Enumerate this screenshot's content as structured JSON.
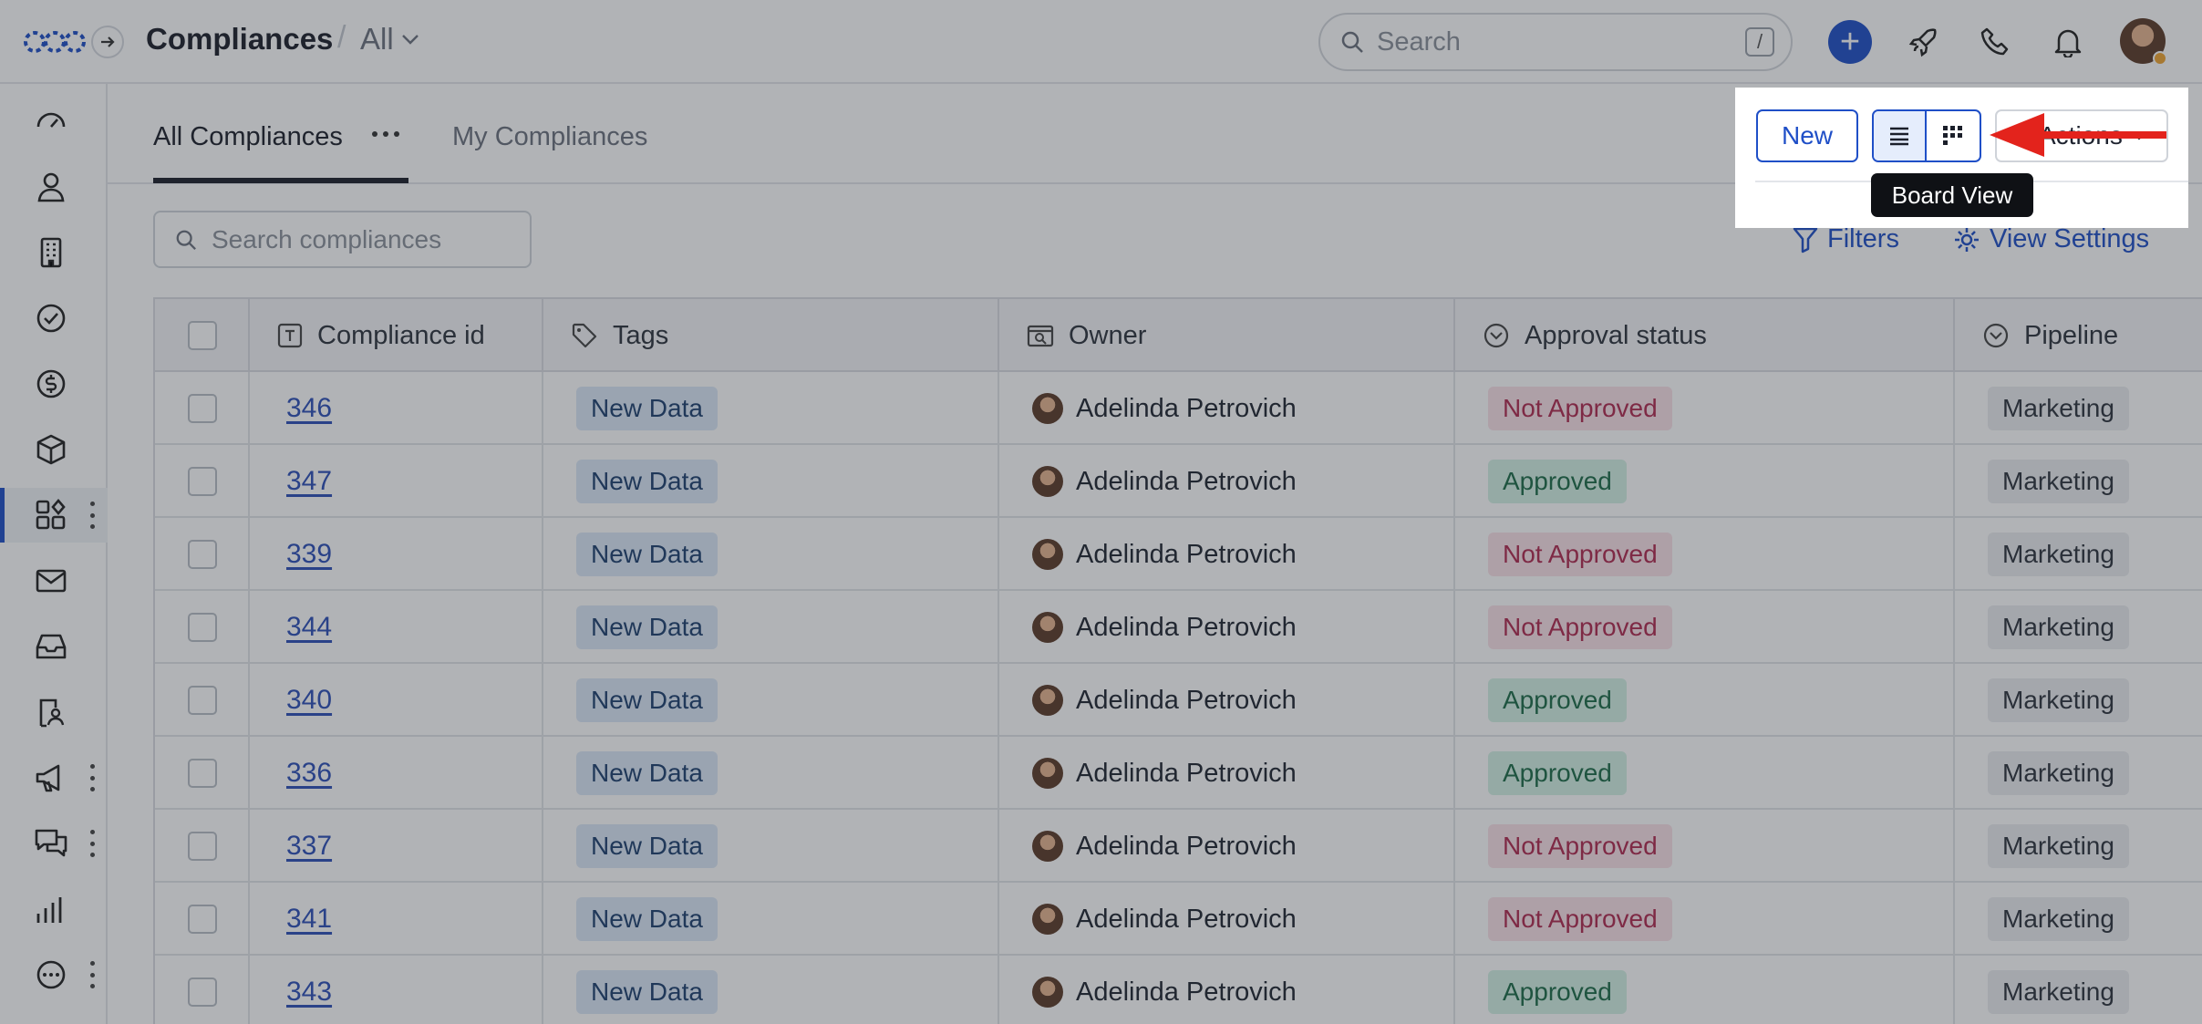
{
  "header": {
    "title": "Compliances",
    "separator": "/",
    "view_selector": "All",
    "search_placeholder": "Search",
    "search_shortcut": "/",
    "add_symbol": "+"
  },
  "sidebar": {
    "items": [
      {
        "icon": "gauge-icon"
      },
      {
        "icon": "person-icon"
      },
      {
        "icon": "building-icon"
      },
      {
        "icon": "check-circle-icon"
      },
      {
        "icon": "dollar-icon"
      },
      {
        "icon": "box-icon"
      },
      {
        "icon": "apps-icon",
        "active": true
      },
      {
        "icon": "mail-icon"
      },
      {
        "icon": "inbox-icon"
      },
      {
        "icon": "contact-card-icon"
      },
      {
        "icon": "megaphone-icon"
      },
      {
        "icon": "chat-icon"
      },
      {
        "icon": "bar-chart-icon"
      },
      {
        "icon": "more-circle-icon"
      }
    ]
  },
  "tabs": {
    "all": "All Compliances",
    "mine": "My Compliances"
  },
  "toolbar": {
    "new_label": "New",
    "actions_label": "Actions",
    "tooltip": "Board View",
    "search_placeholder": "Search compliances",
    "filters_label": "Filters",
    "view_settings_label": "View Settings"
  },
  "table": {
    "columns": {
      "id": "Compliance id",
      "tags": "Tags",
      "owner": "Owner",
      "approval": "Approval status",
      "pipeline": "Pipeline"
    },
    "rows": [
      {
        "id": "346",
        "tag": "New Data",
        "owner": "Adelinda Petrovich",
        "status": "Not Approved",
        "pipeline": "Marketing"
      },
      {
        "id": "347",
        "tag": "New Data",
        "owner": "Adelinda Petrovich",
        "status": "Approved",
        "pipeline": "Marketing"
      },
      {
        "id": "339",
        "tag": "New Data",
        "owner": "Adelinda Petrovich",
        "status": "Not Approved",
        "pipeline": "Marketing"
      },
      {
        "id": "344",
        "tag": "New Data",
        "owner": "Adelinda Petrovich",
        "status": "Not Approved",
        "pipeline": "Marketing"
      },
      {
        "id": "340",
        "tag": "New Data",
        "owner": "Adelinda Petrovich",
        "status": "Approved",
        "pipeline": "Marketing"
      },
      {
        "id": "336",
        "tag": "New Data",
        "owner": "Adelinda Petrovich",
        "status": "Approved",
        "pipeline": "Marketing"
      },
      {
        "id": "337",
        "tag": "New Data",
        "owner": "Adelinda Petrovich",
        "status": "Not Approved",
        "pipeline": "Marketing"
      },
      {
        "id": "341",
        "tag": "New Data",
        "owner": "Adelinda Petrovich",
        "status": "Not Approved",
        "pipeline": "Marketing"
      },
      {
        "id": "343",
        "tag": "New Data",
        "owner": "Adelinda Petrovich",
        "status": "Approved",
        "pipeline": "Marketing"
      }
    ]
  },
  "colors": {
    "accent": "#1f4fc7",
    "annotation_arrow": "#e3231c"
  }
}
